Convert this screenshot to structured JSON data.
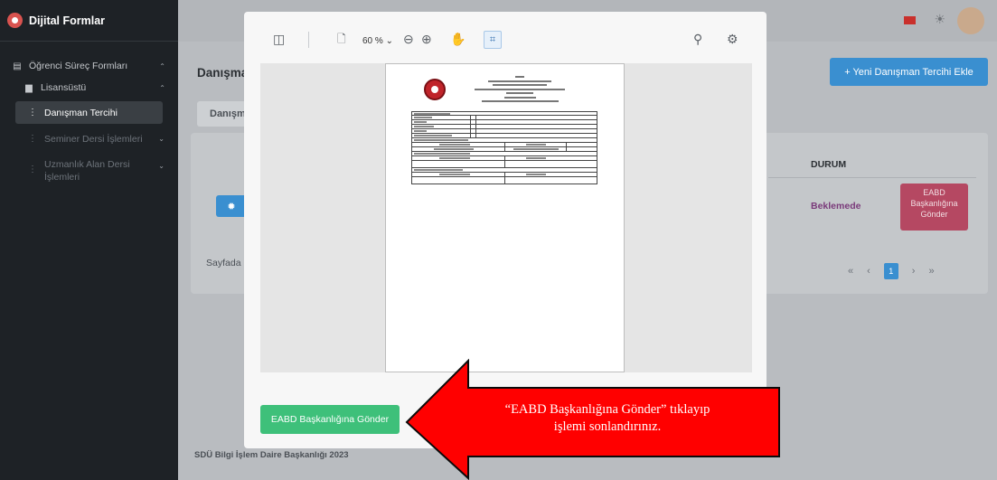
{
  "app": {
    "title": "Dijital Formlar"
  },
  "sidebar": {
    "items": [
      {
        "label": "Öğrenci Süreç Formları"
      },
      {
        "label": "Lisansüstü"
      },
      {
        "label": "Danışman Tercihi"
      },
      {
        "label": "Seminer Dersi İşlemleri"
      },
      {
        "label": "Uzmanlık Alan Dersi İşlemleri"
      }
    ]
  },
  "page": {
    "title": "Danışma",
    "new_button": "+  Yeni Danışman Tercihi Ekle",
    "tab": "Danışm",
    "table": {
      "status_header": "DURUM",
      "status_value": "Beklemede",
      "row_action": "EABD Başkanlığına Gönder"
    },
    "pagination": {
      "label": "Sayfada",
      "current": "1",
      "first": "«",
      "prev": "‹",
      "next": "›",
      "last": "»"
    },
    "footer": "SDÜ Bilgi İşlem Daire Başkanlığı 2023"
  },
  "pdf_viewer": {
    "zoom": "60 % ⌄"
  },
  "modal": {
    "send_button": "EABD Başkanlığına Gönder"
  },
  "callout": {
    "line1": "“EABD Başkanlığına Gönder” tıklayıp",
    "line2": "işlemi sonlandırınız.",
    "color": "#ff0000"
  }
}
